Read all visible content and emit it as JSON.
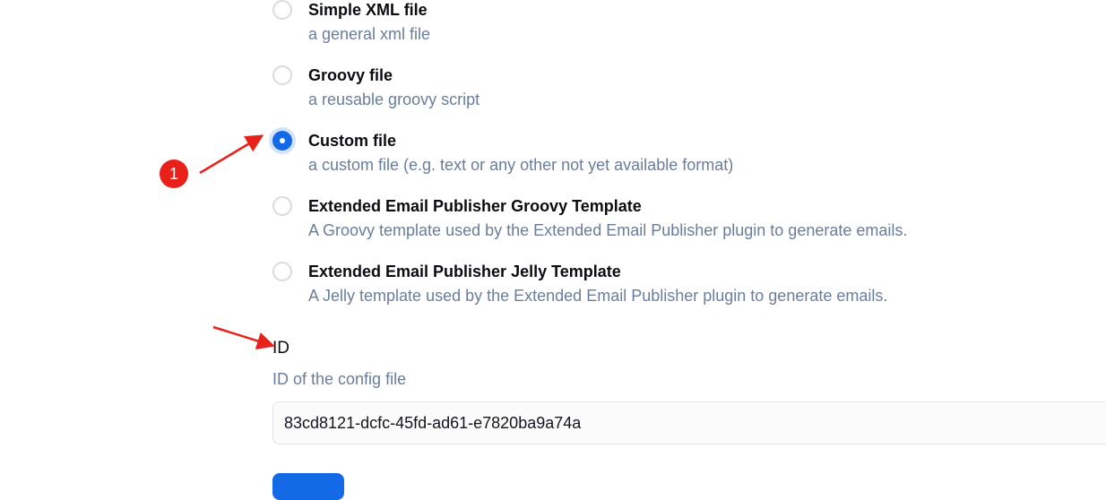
{
  "options": [
    {
      "title": "Simple XML file",
      "desc": "a general xml file",
      "selected": false
    },
    {
      "title": "Groovy file",
      "desc": "a reusable groovy script",
      "selected": false
    },
    {
      "title": "Custom file",
      "desc": "a custom file (e.g. text or any other not yet available format)",
      "selected": true
    },
    {
      "title": "Extended Email Publisher Groovy Template",
      "desc": "A Groovy template used by the Extended Email Publisher plugin to generate emails.",
      "selected": false
    },
    {
      "title": "Extended Email Publisher Jelly Template",
      "desc": "A Jelly template used by the Extended Email Publisher plugin to generate emails.",
      "selected": false
    }
  ],
  "id_field": {
    "label": "ID",
    "description": "ID of the config file",
    "value": "83cd8121-dcfc-45fd-ad61-e7820ba9a74a"
  },
  "annotation": {
    "badge": "1",
    "color": "#e8211a"
  },
  "colors": {
    "accent": "#1469e6",
    "description_text": "#6a7d9c"
  }
}
